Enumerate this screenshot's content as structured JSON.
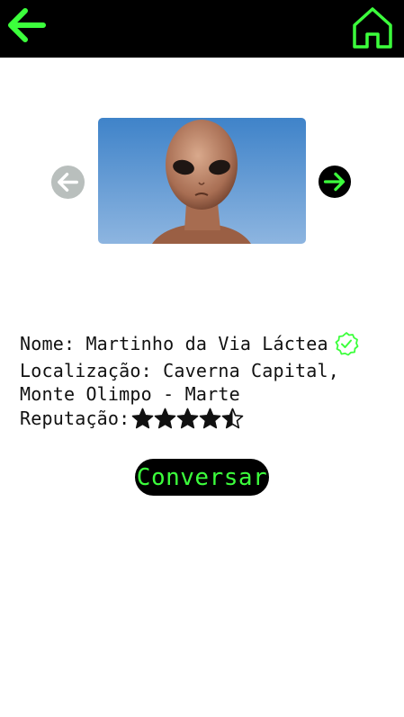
{
  "header": {
    "back_icon": "arrow-left-icon",
    "home_icon": "home-icon"
  },
  "carousel": {
    "prev_icon": "arrow-left-circle-icon",
    "next_icon": "arrow-right-circle-icon",
    "image": "alien-photo"
  },
  "profile": {
    "name_line": "Nome: Martinho da Via Láctea",
    "verified_icon": "verified-badge-icon",
    "location_line_1": "Localização: Caverna Capital,",
    "location_line_2": "Monte Olimpo - Marte",
    "reputation_label": "Reputação:",
    "reputation_stars": 4.5,
    "reputation_max": 5
  },
  "actions": {
    "chat_label": "Conversar"
  },
  "colors": {
    "accent": "#3cff3c",
    "bar": "#000000",
    "prev_disabled": "#b9bfbd"
  }
}
